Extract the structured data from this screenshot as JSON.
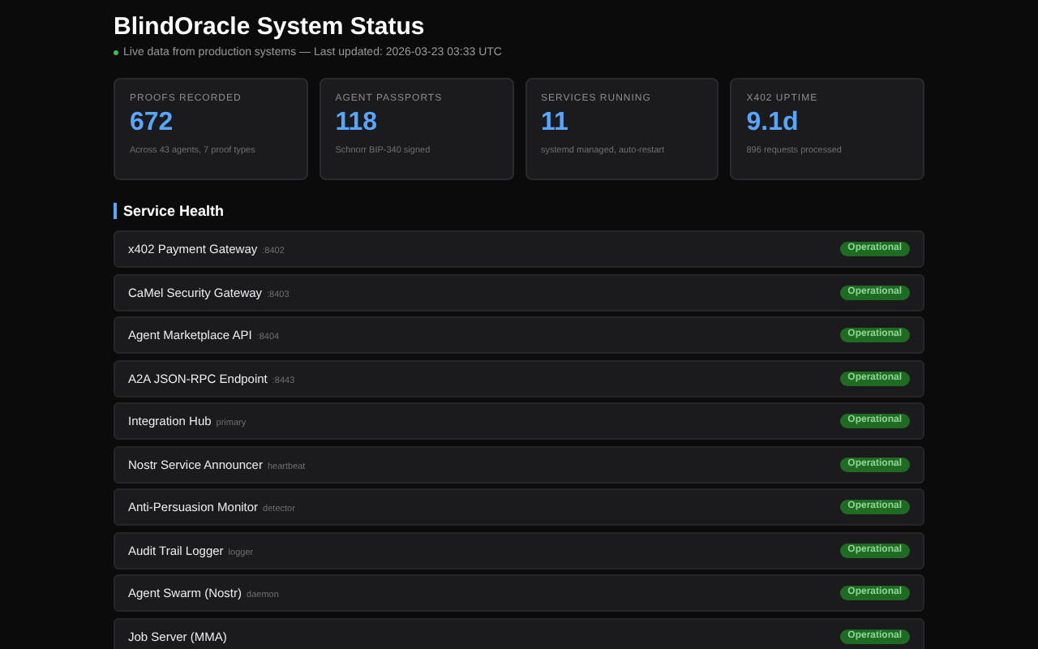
{
  "header": {
    "title": "BlindOracle System Status",
    "live_dot": true,
    "subtitle": "Live data from production systems — Last updated: 2026-03-23 03:33 UTC"
  },
  "stats": [
    {
      "label": "PROOFS RECORDED",
      "value": "672",
      "note": "Across 43 agents, 7 proof types"
    },
    {
      "label": "AGENT PASSPORTS",
      "value": "118",
      "note": "Schnorr BIP-340 signed"
    },
    {
      "label": "SERVICES RUNNING",
      "value": "11",
      "note": "systemd managed, auto-restart"
    },
    {
      "label": "X402 UPTIME",
      "value": "9.1d",
      "note": "896 requests processed"
    }
  ],
  "service_health": {
    "title": "Service Health",
    "services": [
      {
        "name": "x402 Payment Gateway",
        "detail": ":8402",
        "operational": true,
        "badge": "Operational"
      },
      {
        "name": "CaMel Security Gateway",
        "detail": ":8403",
        "operational": true,
        "badge": "Operational"
      },
      {
        "name": "Agent Marketplace API",
        "detail": ":8404",
        "operational": true,
        "badge": "Operational"
      },
      {
        "name": "A2A JSON-RPC Endpoint",
        "detail": ":8443",
        "operational": true,
        "badge": "Operational"
      },
      {
        "name": "Integration Hub",
        "detail": "primary",
        "operational": true,
        "badge": "Operational"
      },
      {
        "name": "Nostr Service Announcer",
        "detail": "heartbeat",
        "operational": true,
        "badge": "Operational"
      },
      {
        "name": "Anti-Persuasion Monitor",
        "detail": "detector",
        "operational": true,
        "badge": "Operational"
      },
      {
        "name": "Audit Trail Logger",
        "detail": "logger",
        "operational": true,
        "badge": "Operational"
      },
      {
        "name": "Agent Swarm (Nostr)",
        "detail": "daemon",
        "operational": true,
        "badge": "Operational"
      },
      {
        "name": "Job Server (MMA)",
        "operational": true,
        "badge": "Operational"
      }
    ]
  }
}
